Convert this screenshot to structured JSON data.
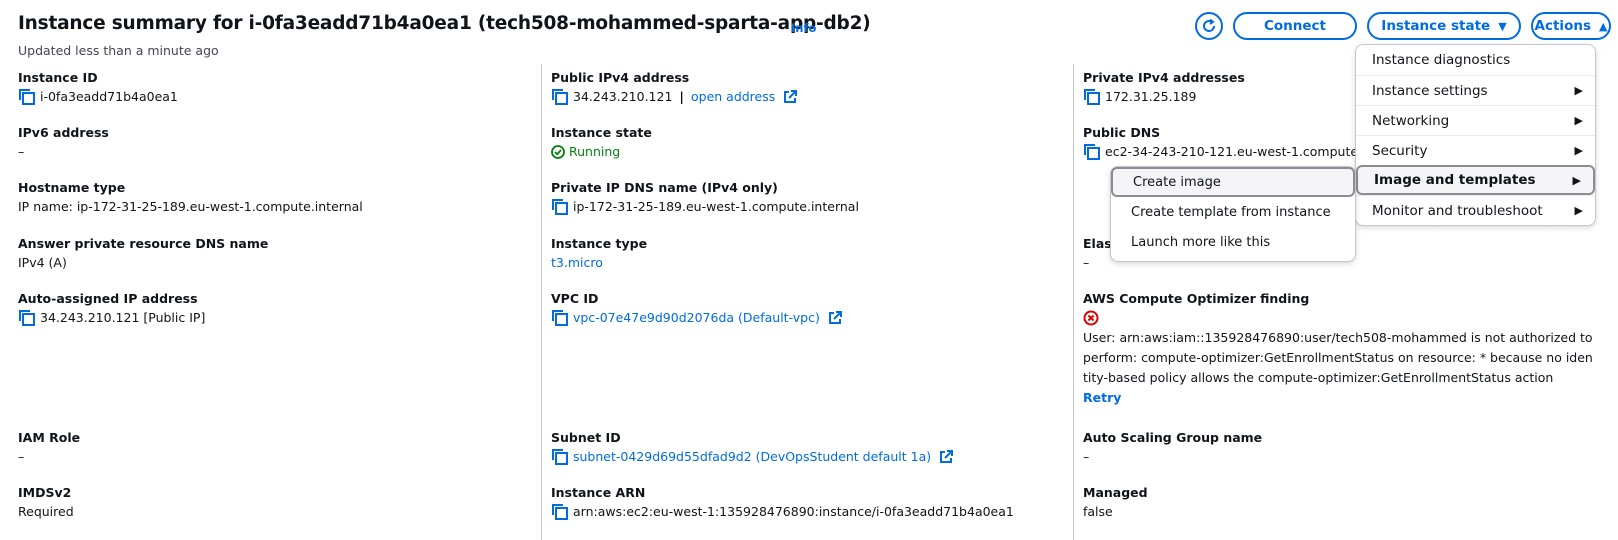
{
  "header": {
    "title": "Instance summary for i-0fa3eadd71b4a0ea1 (tech508-mohammed-sparta-app-db2)",
    "info_label": "Info",
    "subtitle": "Updated less than a minute ago",
    "connect_label": "Connect",
    "instance_state_label": "Instance state",
    "actions_label": "Actions"
  },
  "col1": {
    "instance_id_label": "Instance ID",
    "instance_id": "i-0fa3eadd71b4a0ea1",
    "ipv6_label": "IPv6 address",
    "ipv6": "–",
    "hostname_type_label": "Hostname type",
    "hostname_type": "IP name: ip-172-31-25-189.eu-west-1.compute.internal",
    "answer_dns_label": "Answer private resource DNS name",
    "answer_dns": "IPv4 (A)",
    "auto_ip_label": "Auto-assigned IP address",
    "auto_ip": "34.243.210.121 [Public IP]",
    "iam_role_label": "IAM Role",
    "iam_role": "–",
    "imdsv2_label": "IMDSv2",
    "imdsv2": "Required"
  },
  "col2": {
    "public_ipv4_label": "Public IPv4 address",
    "public_ipv4": "34.243.210.121",
    "open_address": "open address",
    "instance_state_label": "Instance state",
    "instance_state": "Running",
    "private_dns_label": "Private IP DNS name (IPv4 only)",
    "private_dns": "ip-172-31-25-189.eu-west-1.compute.internal",
    "instance_type_label": "Instance type",
    "instance_type": "t3.micro",
    "vpc_label": "VPC ID",
    "vpc": "vpc-07e47e9d90d2076da (Default-vpc)",
    "subnet_label": "Subnet ID",
    "subnet": "subnet-0429d69d55dfad9d2 (DevOpsStudent default 1a)",
    "arn_label": "Instance ARN",
    "arn": "arn:aws:ec2:eu-west-1:135928476890:instance/i-0fa3eadd71b4a0ea1"
  },
  "col3": {
    "private_ipv4_label": "Private IPv4 addresses",
    "private_ipv4": "172.31.25.189",
    "public_dns_label": "Public DNS",
    "public_dns": "ec2-34-243-210-121.eu-west-1.compute",
    "elastic_label": "Elas",
    "elastic": "–",
    "optimizer_label": "AWS Compute Optimizer finding",
    "optimizer_error": "User: arn:aws:iam::135928476890:user/tech508-mohammed is not authorized to perform: compute-optimizer:GetEnrollmentStatus on resource: * because no identity-based policy allows the compute-optimizer:GetEnrollmentStatus action",
    "retry": "Retry",
    "asg_label": "Auto Scaling Group name",
    "asg": "–",
    "managed_label": "Managed",
    "managed": "false"
  },
  "actions_menu": {
    "items": [
      {
        "label": "Instance diagnostics"
      },
      {
        "label": "Instance settings"
      },
      {
        "label": "Networking"
      },
      {
        "label": "Security"
      },
      {
        "label": "Image and templates"
      },
      {
        "label": "Monitor and troubleshoot"
      }
    ],
    "submenu": [
      {
        "label": "Create image"
      },
      {
        "label": "Create template from instance"
      },
      {
        "label": "Launch more like this"
      }
    ]
  },
  "colors": {
    "link": "#006ce0",
    "success": "#037f0c",
    "error": "#db0000",
    "divider": "#c6c6cd"
  }
}
